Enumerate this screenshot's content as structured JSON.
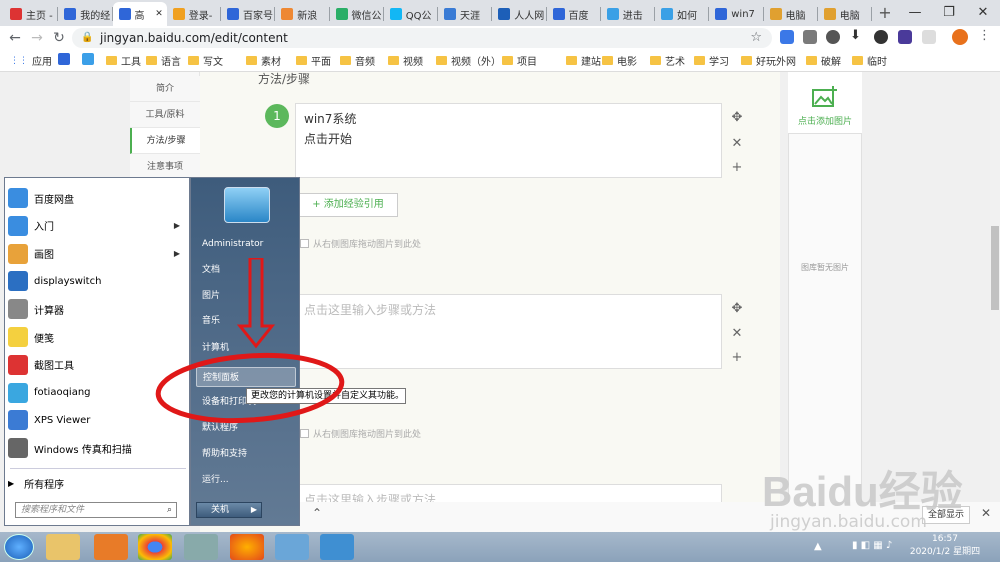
{
  "tabs": [
    {
      "label": "主页 -",
      "color": "#d33"
    },
    {
      "label": "我的经",
      "color": "#2f66d8"
    },
    {
      "label": "高",
      "color": "#2f66d8",
      "active": true
    },
    {
      "label": "登录-",
      "color": "#f0a020"
    },
    {
      "label": "百家号",
      "color": "#2f66d8"
    },
    {
      "label": "新浪",
      "color": "#e83"
    },
    {
      "label": "微信公",
      "color": "#2aae67"
    },
    {
      "label": "QQ公",
      "color": "#12b7f5"
    },
    {
      "label": "天涯",
      "color": "#3a7bd5"
    },
    {
      "label": "人人网",
      "color": "#1d5fb8"
    },
    {
      "label": "百度",
      "color": "#2f66d8"
    },
    {
      "label": "进击",
      "color": "#3aa0e6"
    },
    {
      "label": "如何",
      "color": "#3aa0e6"
    },
    {
      "label": "win7",
      "color": "#2f66d8"
    },
    {
      "label": "电脑",
      "color": "#e0a030"
    },
    {
      "label": "电脑",
      "color": "#e0a030"
    }
  ],
  "new_tab": "+",
  "window_controls": {
    "minimize": "—",
    "restore": "❐",
    "close": "✕"
  },
  "address": {
    "url": "jingyan.baidu.com/edit/content"
  },
  "bookmarks": [
    "应用",
    "",
    "",
    "工具",
    "语言",
    "写文",
    "素材",
    "平面",
    "音频",
    "视频",
    "视频（外）",
    "项目",
    "建站",
    "电影",
    "艺术",
    "学习",
    "好玩外网",
    "破解",
    "临时"
  ],
  "left_nav": [
    "简介",
    "工具/原料",
    "方法/步骤",
    "注意事项"
  ],
  "section_title": "方法/步骤",
  "step1": {
    "number": "1",
    "line1": "win7系统",
    "line2": "点击开始"
  },
  "step_placeholder": "点击这里输入步骤或方法",
  "add_reference": "+ 添加经验引用",
  "drag_tip": "从右侧图库拖动图片到此处",
  "add_image": "点击添加图片",
  "gallery_empty": "图库暂无图片",
  "show_all": "全部显示",
  "start_menu": {
    "programs": [
      "百度网盘",
      "入门",
      "画图",
      "displayswitch",
      "计算器",
      "便笺",
      "截图工具",
      "fotiaoqiang",
      "XPS Viewer",
      "Windows 传真和扫描"
    ],
    "all_programs": "所有程序",
    "search_placeholder": "搜索程序和文件",
    "user": "Administrator",
    "right_links": [
      "文档",
      "图片",
      "音乐",
      "计算机",
      "控制面板",
      "设备和打印机",
      "默认程序",
      "帮助和支持",
      "运行..."
    ],
    "shutdown": "关机",
    "tooltip": "更改您的计算机设置并自定义其功能。"
  },
  "watermark": {
    "brand": "Baidu经验",
    "url": "jingyan.baidu.com"
  },
  "clock": {
    "time": "16:57",
    "date": "2020/1/2 星期四"
  },
  "colors": {
    "accent_green": "#5cb85c",
    "annotation_red": "#e01818"
  }
}
